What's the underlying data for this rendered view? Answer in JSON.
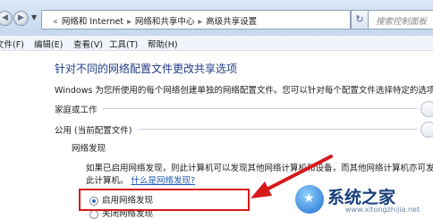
{
  "address_bar": {
    "breadcrumbs": [
      "网络和 Internet",
      "网络和共享中心",
      "高级共享设置"
    ],
    "search_placeholder": "搜索控制面板"
  },
  "menu": [
    "文件(F)",
    "编辑(E)",
    "查看(V)",
    "工具(T)",
    "帮助(H)"
  ],
  "page": {
    "title": "针对不同的网络配置文件更改共享选项",
    "intro": "Windows 为您所使用的每个网络创建单独的网络配置文件。您可以针对每个配置文件选择特定的选项。",
    "profiles": [
      {
        "label": "家庭或工作"
      },
      {
        "label": "公用 (当前配置文件)"
      }
    ],
    "discovery": {
      "heading": "网络发现",
      "description_line1": "如果已启用网络发现，则此计算机可以发现其他网络计算机和设备，而其他网络计算机亦可发现",
      "description_line2": "此计算机。",
      "link": "什么是网络发现?",
      "options": [
        {
          "label": "启用网络发现",
          "selected": true
        },
        {
          "label": "关闭网络发现",
          "selected": false
        }
      ]
    }
  },
  "watermark": {
    "title": "系统之家",
    "url": "www.xitongzhijia.net"
  },
  "colors": {
    "highlight": "#d7191a",
    "title": "#1f3c86",
    "link": "#1e5ab4"
  }
}
